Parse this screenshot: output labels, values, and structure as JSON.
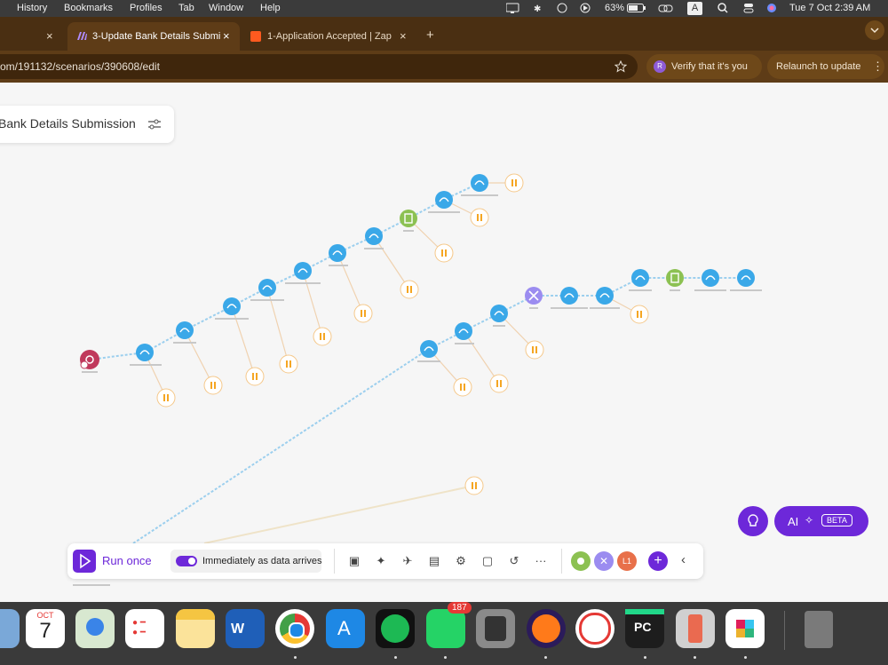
{
  "menubar": {
    "items": [
      "History",
      "Bookmarks",
      "Profiles",
      "Tab",
      "Window",
      "Help"
    ],
    "battery": "63%",
    "keyboard": "A",
    "clock": "Tue 7 Oct  2:39 AM"
  },
  "tabs": [
    {
      "title": "3-Update Bank Details Submi",
      "close": "×"
    },
    {
      "title": "1-Application Accepted | Zap",
      "close": "×"
    }
  ],
  "leftTabClose": "×",
  "newTab": "+",
  "url": "om/191132/scenarios/390608/edit",
  "verify": {
    "avatar": "R",
    "label": "Verify that it's you"
  },
  "relaunch": {
    "label": "Relaunch to update"
  },
  "scenario": {
    "title": "Bank Details Submission"
  },
  "toolbar": {
    "run_label": "Run once",
    "schedule_label": "Immediately as data arrives",
    "badge_l1": "L1"
  },
  "ai": {
    "label": "AI",
    "beta": "BETA"
  },
  "dock": {
    "calendar_month": "OCT",
    "calendar_day": "7",
    "whatsapp_badge": "187"
  },
  "icons": [
    "menubar-icons",
    "bulb-icon",
    "sparkle-icon",
    "play-icon",
    "save-icon",
    "wand-icon",
    "plane-icon",
    "template-icon",
    "gear-icon",
    "note-icon",
    "undo-icon",
    "more-icon",
    "chevron-left-icon",
    "star-icon"
  ],
  "colors": {
    "accent": "#6d28d9",
    "node": "#3aa8e8",
    "router": "#9b8cf0",
    "sleep": "#f5a623",
    "webhook": "#c0395c",
    "filter": "#8cc152"
  }
}
